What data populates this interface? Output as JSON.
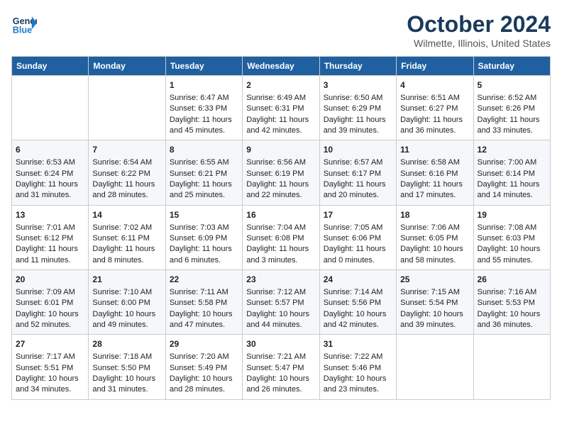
{
  "header": {
    "logo_line1": "General",
    "logo_line2": "Blue",
    "month": "October 2024",
    "location": "Wilmette, Illinois, United States"
  },
  "weekdays": [
    "Sunday",
    "Monday",
    "Tuesday",
    "Wednesday",
    "Thursday",
    "Friday",
    "Saturday"
  ],
  "weeks": [
    [
      {
        "day": "",
        "sunrise": "",
        "sunset": "",
        "daylight": ""
      },
      {
        "day": "",
        "sunrise": "",
        "sunset": "",
        "daylight": ""
      },
      {
        "day": "1",
        "sunrise": "Sunrise: 6:47 AM",
        "sunset": "Sunset: 6:33 PM",
        "daylight": "Daylight: 11 hours and 45 minutes."
      },
      {
        "day": "2",
        "sunrise": "Sunrise: 6:49 AM",
        "sunset": "Sunset: 6:31 PM",
        "daylight": "Daylight: 11 hours and 42 minutes."
      },
      {
        "day": "3",
        "sunrise": "Sunrise: 6:50 AM",
        "sunset": "Sunset: 6:29 PM",
        "daylight": "Daylight: 11 hours and 39 minutes."
      },
      {
        "day": "4",
        "sunrise": "Sunrise: 6:51 AM",
        "sunset": "Sunset: 6:27 PM",
        "daylight": "Daylight: 11 hours and 36 minutes."
      },
      {
        "day": "5",
        "sunrise": "Sunrise: 6:52 AM",
        "sunset": "Sunset: 6:26 PM",
        "daylight": "Daylight: 11 hours and 33 minutes."
      }
    ],
    [
      {
        "day": "6",
        "sunrise": "Sunrise: 6:53 AM",
        "sunset": "Sunset: 6:24 PM",
        "daylight": "Daylight: 11 hours and 31 minutes."
      },
      {
        "day": "7",
        "sunrise": "Sunrise: 6:54 AM",
        "sunset": "Sunset: 6:22 PM",
        "daylight": "Daylight: 11 hours and 28 minutes."
      },
      {
        "day": "8",
        "sunrise": "Sunrise: 6:55 AM",
        "sunset": "Sunset: 6:21 PM",
        "daylight": "Daylight: 11 hours and 25 minutes."
      },
      {
        "day": "9",
        "sunrise": "Sunrise: 6:56 AM",
        "sunset": "Sunset: 6:19 PM",
        "daylight": "Daylight: 11 hours and 22 minutes."
      },
      {
        "day": "10",
        "sunrise": "Sunrise: 6:57 AM",
        "sunset": "Sunset: 6:17 PM",
        "daylight": "Daylight: 11 hours and 20 minutes."
      },
      {
        "day": "11",
        "sunrise": "Sunrise: 6:58 AM",
        "sunset": "Sunset: 6:16 PM",
        "daylight": "Daylight: 11 hours and 17 minutes."
      },
      {
        "day": "12",
        "sunrise": "Sunrise: 7:00 AM",
        "sunset": "Sunset: 6:14 PM",
        "daylight": "Daylight: 11 hours and 14 minutes."
      }
    ],
    [
      {
        "day": "13",
        "sunrise": "Sunrise: 7:01 AM",
        "sunset": "Sunset: 6:12 PM",
        "daylight": "Daylight: 11 hours and 11 minutes."
      },
      {
        "day": "14",
        "sunrise": "Sunrise: 7:02 AM",
        "sunset": "Sunset: 6:11 PM",
        "daylight": "Daylight: 11 hours and 8 minutes."
      },
      {
        "day": "15",
        "sunrise": "Sunrise: 7:03 AM",
        "sunset": "Sunset: 6:09 PM",
        "daylight": "Daylight: 11 hours and 6 minutes."
      },
      {
        "day": "16",
        "sunrise": "Sunrise: 7:04 AM",
        "sunset": "Sunset: 6:08 PM",
        "daylight": "Daylight: 11 hours and 3 minutes."
      },
      {
        "day": "17",
        "sunrise": "Sunrise: 7:05 AM",
        "sunset": "Sunset: 6:06 PM",
        "daylight": "Daylight: 11 hours and 0 minutes."
      },
      {
        "day": "18",
        "sunrise": "Sunrise: 7:06 AM",
        "sunset": "Sunset: 6:05 PM",
        "daylight": "Daylight: 10 hours and 58 minutes."
      },
      {
        "day": "19",
        "sunrise": "Sunrise: 7:08 AM",
        "sunset": "Sunset: 6:03 PM",
        "daylight": "Daylight: 10 hours and 55 minutes."
      }
    ],
    [
      {
        "day": "20",
        "sunrise": "Sunrise: 7:09 AM",
        "sunset": "Sunset: 6:01 PM",
        "daylight": "Daylight: 10 hours and 52 minutes."
      },
      {
        "day": "21",
        "sunrise": "Sunrise: 7:10 AM",
        "sunset": "Sunset: 6:00 PM",
        "daylight": "Daylight: 10 hours and 49 minutes."
      },
      {
        "day": "22",
        "sunrise": "Sunrise: 7:11 AM",
        "sunset": "Sunset: 5:58 PM",
        "daylight": "Daylight: 10 hours and 47 minutes."
      },
      {
        "day": "23",
        "sunrise": "Sunrise: 7:12 AM",
        "sunset": "Sunset: 5:57 PM",
        "daylight": "Daylight: 10 hours and 44 minutes."
      },
      {
        "day": "24",
        "sunrise": "Sunrise: 7:14 AM",
        "sunset": "Sunset: 5:56 PM",
        "daylight": "Daylight: 10 hours and 42 minutes."
      },
      {
        "day": "25",
        "sunrise": "Sunrise: 7:15 AM",
        "sunset": "Sunset: 5:54 PM",
        "daylight": "Daylight: 10 hours and 39 minutes."
      },
      {
        "day": "26",
        "sunrise": "Sunrise: 7:16 AM",
        "sunset": "Sunset: 5:53 PM",
        "daylight": "Daylight: 10 hours and 36 minutes."
      }
    ],
    [
      {
        "day": "27",
        "sunrise": "Sunrise: 7:17 AM",
        "sunset": "Sunset: 5:51 PM",
        "daylight": "Daylight: 10 hours and 34 minutes."
      },
      {
        "day": "28",
        "sunrise": "Sunrise: 7:18 AM",
        "sunset": "Sunset: 5:50 PM",
        "daylight": "Daylight: 10 hours and 31 minutes."
      },
      {
        "day": "29",
        "sunrise": "Sunrise: 7:20 AM",
        "sunset": "Sunset: 5:49 PM",
        "daylight": "Daylight: 10 hours and 28 minutes."
      },
      {
        "day": "30",
        "sunrise": "Sunrise: 7:21 AM",
        "sunset": "Sunset: 5:47 PM",
        "daylight": "Daylight: 10 hours and 26 minutes."
      },
      {
        "day": "31",
        "sunrise": "Sunrise: 7:22 AM",
        "sunset": "Sunset: 5:46 PM",
        "daylight": "Daylight: 10 hours and 23 minutes."
      },
      {
        "day": "",
        "sunrise": "",
        "sunset": "",
        "daylight": ""
      },
      {
        "day": "",
        "sunrise": "",
        "sunset": "",
        "daylight": ""
      }
    ]
  ]
}
